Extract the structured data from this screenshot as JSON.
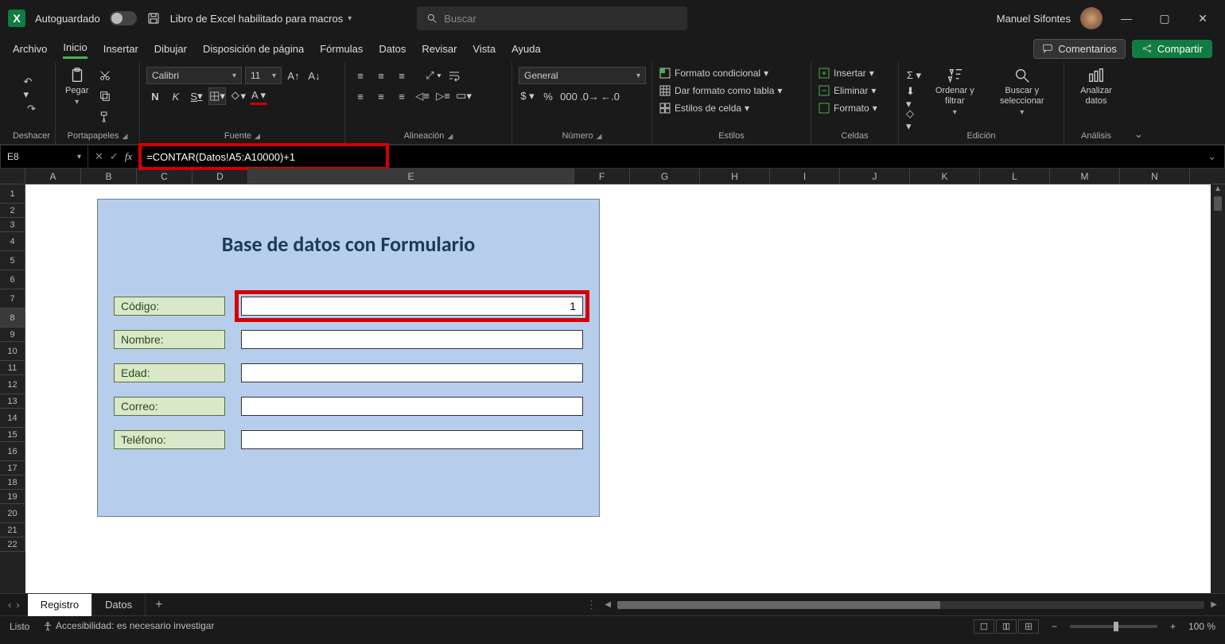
{
  "titlebar": {
    "autosave_label": "Autoguardado",
    "doc_title": "Libro de Excel habilitado para macros",
    "search_placeholder": "Buscar",
    "user_name": "Manuel Sifontes"
  },
  "menu": {
    "tabs": [
      "Archivo",
      "Inicio",
      "Insertar",
      "Dibujar",
      "Disposición de página",
      "Fórmulas",
      "Datos",
      "Revisar",
      "Vista",
      "Ayuda"
    ],
    "active_index": 1,
    "comments": "Comentarios",
    "share": "Compartir"
  },
  "ribbon": {
    "undo_group": "Deshacer",
    "clipboard_group": "Portapapeles",
    "paste": "Pegar",
    "font_group": "Fuente",
    "font_name": "Calibri",
    "font_size": "11",
    "bold": "N",
    "italic": "K",
    "underline": "S",
    "alignment_group": "Alineación",
    "number_group": "Número",
    "number_format": "General",
    "styles_group": "Estilos",
    "cond_format": "Formato condicional",
    "format_table": "Dar formato como tabla",
    "cell_styles": "Estilos de celda",
    "cells_group": "Celdas",
    "insert": "Insertar",
    "delete": "Eliminar",
    "format": "Formato",
    "editing_group": "Edición",
    "sort_filter": "Ordenar y filtrar",
    "find_select": "Buscar y seleccionar",
    "analysis_group": "Análisis",
    "analyze_data": "Analizar datos"
  },
  "formulabar": {
    "cell_ref": "E8",
    "formula": "=CONTAR(Datos!A5:A10000)+1"
  },
  "columns": [
    "A",
    "B",
    "C",
    "D",
    "E",
    "F",
    "G",
    "H",
    "I",
    "J",
    "K",
    "L",
    "M",
    "N"
  ],
  "form": {
    "title": "Base de datos con Formulario",
    "fields": [
      {
        "label": "Código:",
        "value": "1"
      },
      {
        "label": "Nombre:",
        "value": ""
      },
      {
        "label": "Edad:",
        "value": ""
      },
      {
        "label": "Correo:",
        "value": ""
      },
      {
        "label": "Teléfono:",
        "value": ""
      }
    ]
  },
  "sheets": {
    "tabs": [
      "Registro",
      "Datos"
    ],
    "active_index": 0
  },
  "statusbar": {
    "ready": "Listo",
    "accessibility": "Accesibilidad: es necesario investigar",
    "zoom": "100 %"
  }
}
